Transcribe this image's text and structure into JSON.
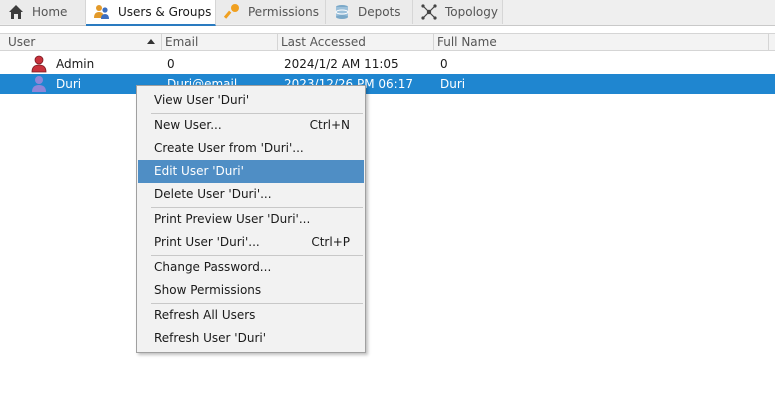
{
  "tabs": [
    {
      "label": "Home",
      "icon": "home-icon",
      "active": false
    },
    {
      "label": "Users & Groups",
      "icon": "users-groups-icon",
      "active": true
    },
    {
      "label": "Permissions",
      "icon": "key-icon",
      "active": false
    },
    {
      "label": "Depots",
      "icon": "database-icon",
      "active": false
    },
    {
      "label": "Topology",
      "icon": "topology-icon",
      "active": false
    }
  ],
  "table": {
    "columns": [
      "User",
      "Email",
      "Last Accessed",
      "Full Name"
    ],
    "sort_column": "User",
    "sort_direction": "ascending",
    "rows": [
      {
        "user": "Admin",
        "email": "0",
        "last_accessed": "2024/1/2 AM 11:05",
        "full_name": "0",
        "icon": "admin-user-icon",
        "selected": false
      },
      {
        "user": "Duri",
        "email": "Duri@email...",
        "last_accessed": "2023/12/26 PM 06:17",
        "full_name": "Duri",
        "icon": "user-icon",
        "selected": true
      }
    ]
  },
  "context_menu": {
    "items": [
      {
        "label": "View User 'Duri'",
        "shortcut": ""
      },
      {
        "label": "New User...",
        "shortcut": "Ctrl+N"
      },
      {
        "label": "Create User from 'Duri'...",
        "shortcut": ""
      },
      {
        "label": "Edit User 'Duri'",
        "shortcut": "",
        "highlighted": true
      },
      {
        "label": "Delete User 'Duri'...",
        "shortcut": ""
      },
      {
        "label": "Print Preview User 'Duri'...",
        "shortcut": ""
      },
      {
        "label": "Print User 'Duri'...",
        "shortcut": "Ctrl+P"
      },
      {
        "label": "Change Password...",
        "shortcut": ""
      },
      {
        "label": "Show Permissions",
        "shortcut": ""
      },
      {
        "label": "Refresh All Users",
        "shortcut": ""
      },
      {
        "label": "Refresh User 'Duri'",
        "shortcut": ""
      }
    ]
  },
  "colors": {
    "accent": "#1f86d0",
    "menu_highlight": "#4f8ec5"
  }
}
